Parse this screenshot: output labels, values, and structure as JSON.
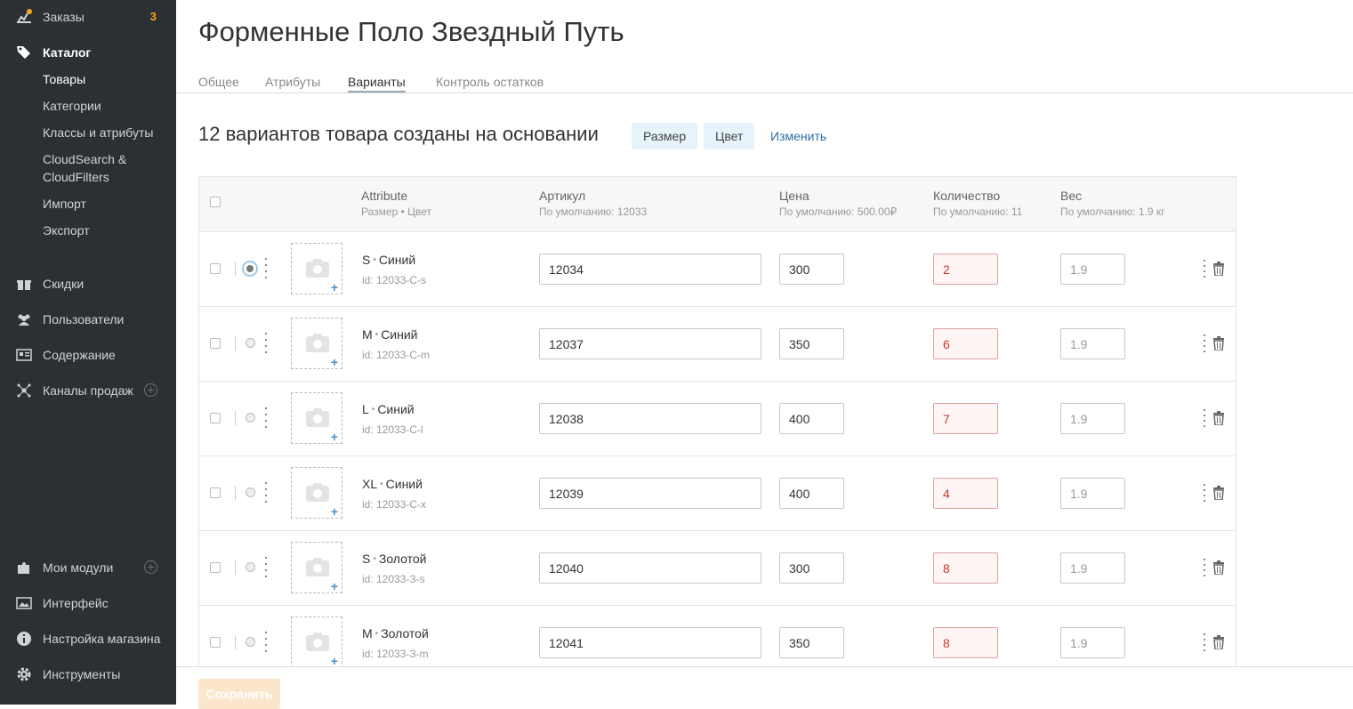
{
  "sidebar": {
    "orders": {
      "label": "Заказы",
      "badge": "3"
    },
    "catalog": {
      "label": "Каталог"
    },
    "catalog_items": [
      "Товары",
      "Категории",
      "Классы и атрибуты",
      "CloudSearch &",
      "CloudFilters",
      "Импорт",
      "Экспорт"
    ],
    "discounts": "Скидки",
    "users": "Пользователи",
    "content": "Содержание",
    "channels": "Каналы продаж",
    "modules": "Мои модули",
    "interface": "Интерфейс",
    "store_settings": "Настройка магазина",
    "tools": "Инструменты"
  },
  "page": {
    "title": "Форменные Поло Звездный Путь",
    "tabs": [
      "Общее",
      "Атрибуты",
      "Варианты",
      "Контроль остатков"
    ],
    "variants_heading": "12 вариантов товара созданы на основании",
    "chips": [
      "Размер",
      "Цвет"
    ],
    "edit_link": "Изменить",
    "save_button": "Сохранить"
  },
  "table": {
    "columns": {
      "attribute": {
        "label": "Attribute",
        "default": "Размер • Цвет"
      },
      "sku": {
        "label": "Артикул",
        "default": "По умолчанию: 12033"
      },
      "price": {
        "label": "Цена",
        "default": "По умолчанию: 500.00₽"
      },
      "qty": {
        "label": "Количество",
        "default": "По умолчанию: 11"
      },
      "weight": {
        "label": "Вес",
        "default": "По умолчанию: 1.9 кг"
      }
    },
    "rows": [
      {
        "size": "S",
        "color": "Синий",
        "id": "id: 12033-С-s",
        "sku": "12034",
        "price": "300",
        "qty": "2",
        "weight_placeholder": "1.9",
        "default": true
      },
      {
        "size": "M",
        "color": "Синий",
        "id": "id: 12033-С-m",
        "sku": "12037",
        "price": "350",
        "qty": "6",
        "weight_placeholder": "1.9",
        "default": false
      },
      {
        "size": "L",
        "color": "Синий",
        "id": "id: 12033-С-l",
        "sku": "12038",
        "price": "400",
        "qty": "7",
        "weight_placeholder": "1.9",
        "default": false
      },
      {
        "size": "XL",
        "color": "Синий",
        "id": "id: 12033-С-x",
        "sku": "12039",
        "price": "400",
        "qty": "4",
        "weight_placeholder": "1.9",
        "default": false
      },
      {
        "size": "S",
        "color": "Золотой",
        "id": "id: 12033-З-s",
        "sku": "12040",
        "price": "300",
        "qty": "8",
        "weight_placeholder": "1.9",
        "default": false
      },
      {
        "size": "M",
        "color": "Золотой",
        "id": "id: 12033-З-m",
        "sku": "12041",
        "price": "350",
        "qty": "8",
        "weight_placeholder": "1.9",
        "default": false
      }
    ]
  }
}
